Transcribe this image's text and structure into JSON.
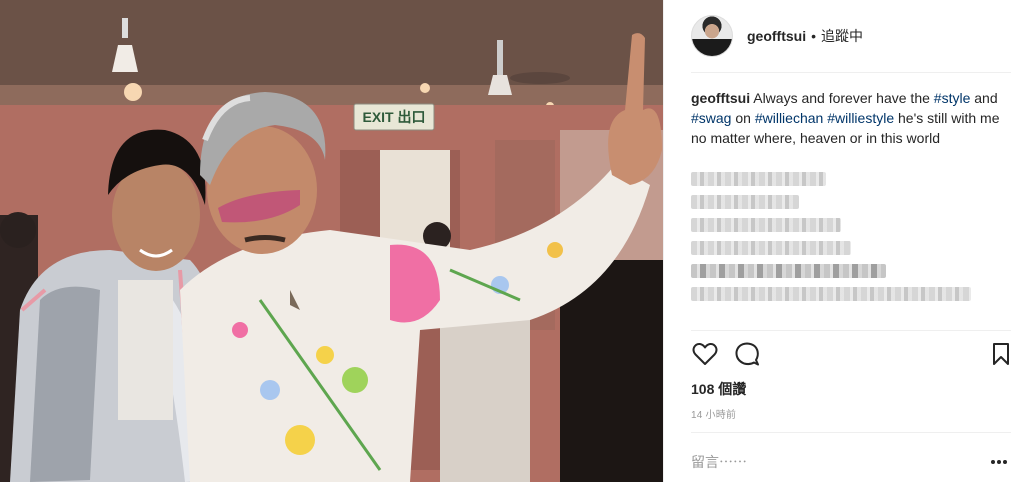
{
  "post": {
    "username": "geofftsui",
    "follow_separator": "•",
    "follow_status": "追蹤中",
    "caption": {
      "username": "geofftsui",
      "text1": "Always and forever have the",
      "tag_style": "#style",
      "text2": "and",
      "tag_swag": "#swag",
      "text3": "on",
      "tag_williechan": "#williechan",
      "tag_williestyle": "#williestyle",
      "text4": "he's still with me no matter where, heaven or in this world"
    },
    "likes": "108 個讚",
    "timestamp": "14 小時前",
    "comment_placeholder": "留言⋯⋯"
  },
  "photo": {
    "exit_sign": "EXIT 出口"
  },
  "icons": {
    "like": "heart-icon",
    "comment": "comment-bubble-icon",
    "save": "bookmark-icon",
    "more": "more-options-icon"
  },
  "colors": {
    "hashtag": "#003569",
    "text": "#262626",
    "muted": "#999999"
  }
}
